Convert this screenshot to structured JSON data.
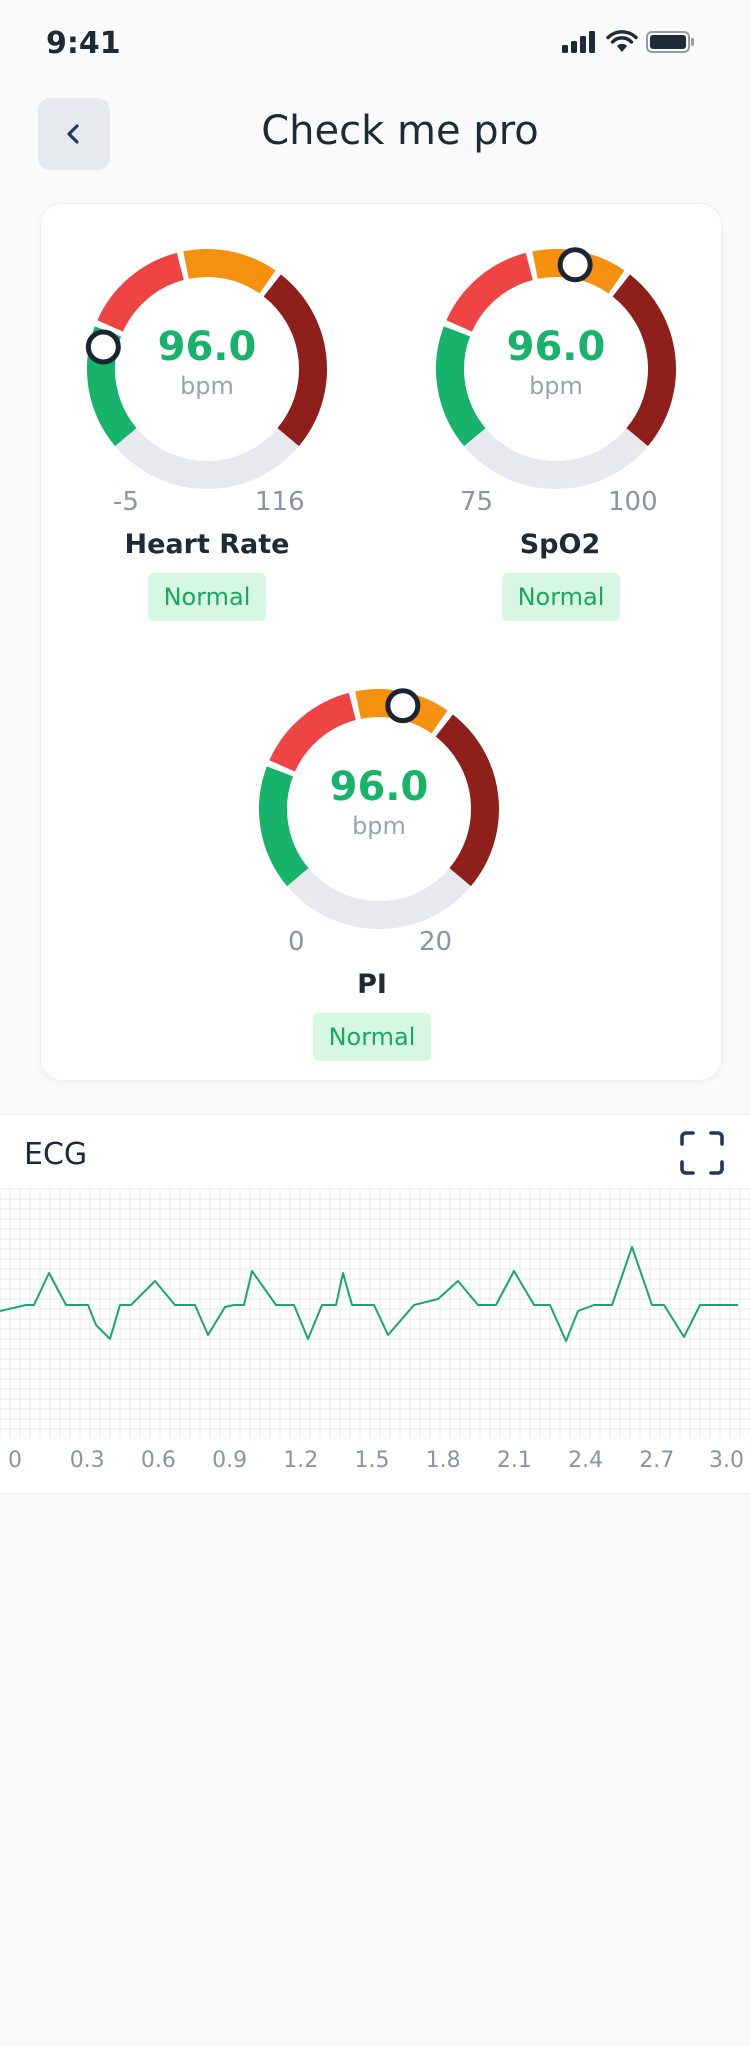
{
  "status_bar": {
    "time": "9:41"
  },
  "header": {
    "title": "Check me pro"
  },
  "colors": {
    "green": "#18b36b",
    "red": "#ef4444",
    "orange": "#f6910f",
    "dark_red": "#8e1f1a",
    "gray": "#e8e9ee",
    "badge_bg": "#d6f7e2",
    "badge_text": "#18a860",
    "ecg_line": "#1aa866"
  },
  "gauges": [
    {
      "key": "heart_rate",
      "label": "Heart Rate",
      "value": "96.0",
      "unit": "bpm",
      "min": "-5",
      "max": "116",
      "status": "Normal",
      "marker_fraction": 0.2
    },
    {
      "key": "spo2",
      "label": "SpO2",
      "value": "96.0",
      "unit": "bpm",
      "min": "75",
      "max": "100",
      "status": "Normal",
      "marker_fraction": 0.54
    },
    {
      "key": "pi",
      "label": "PI",
      "value": "96.0",
      "unit": "bpm",
      "min": "0",
      "max": "20",
      "status": "Normal",
      "marker_fraction": 0.55
    }
  ],
  "ecg": {
    "title": "ECG",
    "x_ticks": [
      "0",
      "0.3",
      "0.6",
      "0.9",
      "1.2",
      "1.5",
      "1.8",
      "2.1",
      "2.4",
      "2.7",
      "3.0"
    ],
    "xlim": [
      0,
      3.0
    ]
  }
}
